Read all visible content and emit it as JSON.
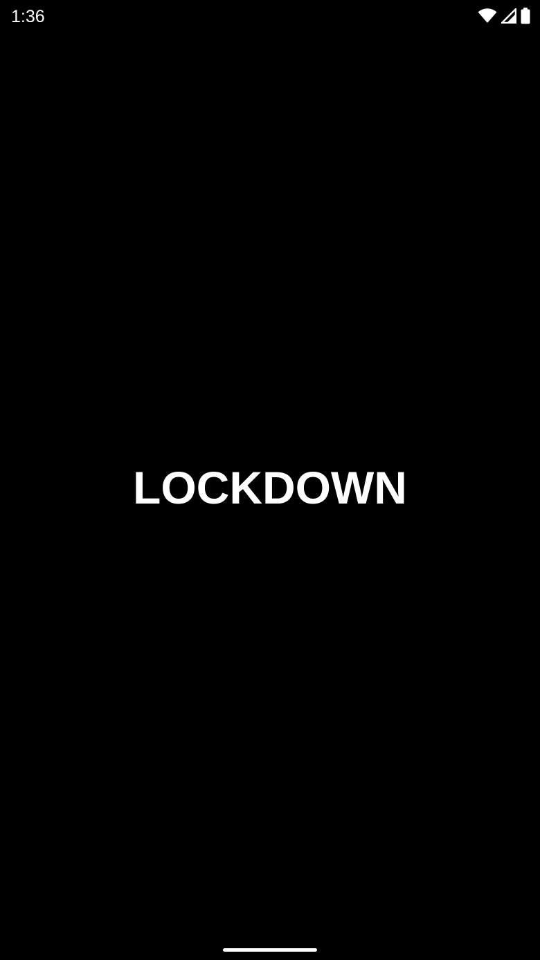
{
  "status_bar": {
    "time": "1:36",
    "icons": [
      "wifi-icon",
      "cellular-signal-icon",
      "battery-icon"
    ]
  },
  "splash": {
    "title": "LOCKDOWN"
  },
  "colors": {
    "background": "#000000",
    "foreground": "#ffffff"
  }
}
